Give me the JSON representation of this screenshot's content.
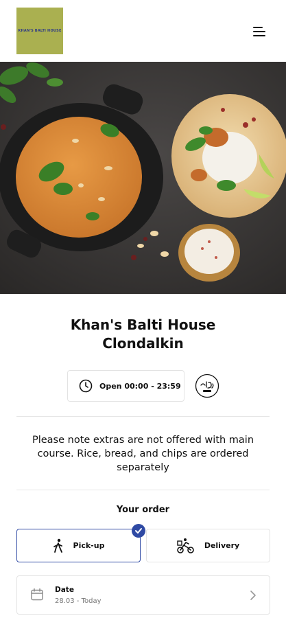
{
  "header": {
    "logo_text": "KHAN'S BALTI HOUSE",
    "logo_color": "#aab050",
    "menu_icon": "hamburger-menu-icon"
  },
  "hero": {
    "description_icon": "food-hero-image"
  },
  "restaurant": {
    "name_line1": "Khan's Balti House",
    "name_line2": "Clondalkin"
  },
  "hours": {
    "icon": "clock-icon",
    "label": "Open 00:00 - 23:59"
  },
  "badges": {
    "halal_icon": "halal-badge-icon"
  },
  "notice": "Please note extras are not offered with main course. Rice, bread, and chips are ordered separately",
  "order": {
    "heading": "Your order",
    "options": [
      {
        "label": "Pick-up",
        "icon": "walking-person-icon",
        "selected": true
      },
      {
        "label": "Delivery",
        "icon": "bicycle-delivery-icon",
        "selected": false
      }
    ],
    "accent_color": "#2f4aa4"
  },
  "date": {
    "label": "Date",
    "value": "28.03 - Today",
    "icon": "calendar-icon"
  }
}
